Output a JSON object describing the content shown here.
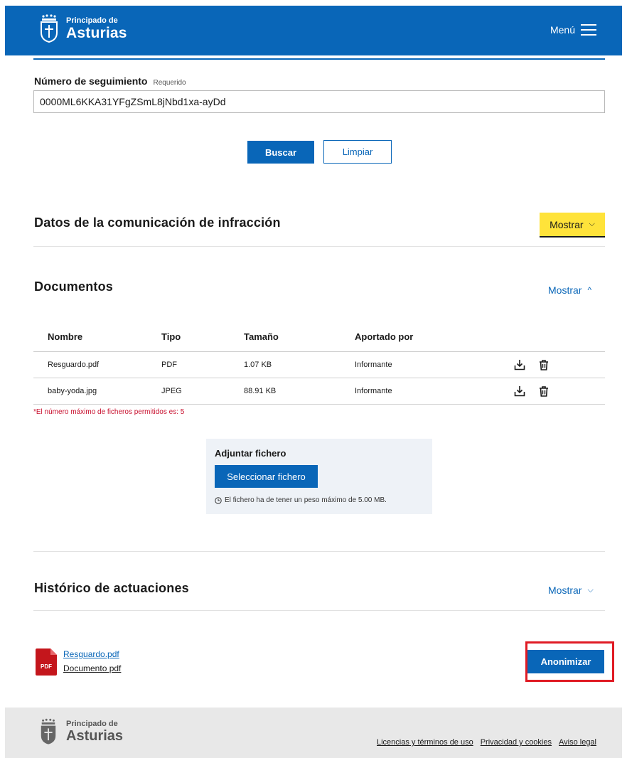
{
  "header": {
    "logo_small": "Principado de",
    "logo_big": "Asturias",
    "menu_label": "Menú"
  },
  "search": {
    "label": "Número de seguimiento",
    "required": "Requerido",
    "value": "0000ML6KKA31YFgZSmL8jNbd1xa-ayDd",
    "buscar_label": "Buscar",
    "limpiar_label": "Limpiar"
  },
  "section_infraccion": {
    "title": "Datos de la comunicación de infracción",
    "toggle_label": "Mostrar"
  },
  "section_documentos": {
    "title": "Documentos",
    "toggle_label": "Mostrar",
    "table": {
      "headers": [
        "Nombre",
        "Tipo",
        "Tamaño",
        "Aportado por"
      ],
      "rows": [
        {
          "nombre": "Resguardo.pdf",
          "tipo": "PDF",
          "tamano": "1.07 KB",
          "aportado": "Informante"
        },
        {
          "nombre": "baby-yoda.jpg",
          "tipo": "JPEG",
          "tamano": "88.91 KB",
          "aportado": "Informante"
        }
      ]
    },
    "max_note": "*El número máximo de ficheros permitidos es: 5",
    "upload": {
      "title": "Adjuntar fichero",
      "button_label": "Seleccionar fichero",
      "hint": "El fichero ha de tener un peso máximo de 5.00 MB."
    }
  },
  "section_historico": {
    "title": "Histórico de actuaciones",
    "toggle_label": "Mostrar"
  },
  "files": {
    "pdf_badge": "PDF",
    "link1": "Resguardo.pdf",
    "link2": "Documento pdf",
    "anonimizar_label": "Anonimizar"
  },
  "footer": {
    "logo_small": "Principado de",
    "logo_big": "Asturias",
    "links": [
      "Licencias y términos de uso",
      "Privacidad y cookies",
      "Aviso legal"
    ]
  },
  "colors": {
    "brand_blue": "#0966b8",
    "yellow": "#ffe33a",
    "highlight_red": "#e01b24",
    "note_red": "#c8102e"
  }
}
